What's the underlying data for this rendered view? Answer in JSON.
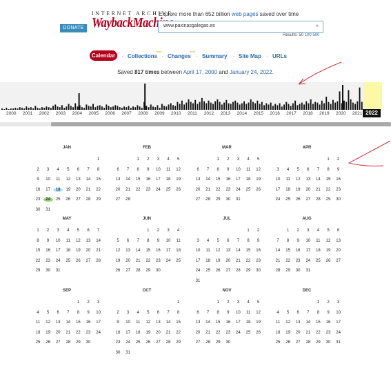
{
  "header": {
    "ia_label": "INTERNET ARCHIVE",
    "wayback_label": "WaybackMachine",
    "donate_label": "DONATE",
    "tagline_pre": "Explore more than 652 billion ",
    "tagline_link": "web pages",
    "tagline_post": " saved over time",
    "search_value": "www.paxinasgalegas.es",
    "clear_icon": "×",
    "results_label": "Results: 50",
    "results_100": "100",
    "results_500": "500"
  },
  "nav": {
    "calendar": "Calendar",
    "collections": "Collections",
    "changes": "Changes",
    "summary": "Summary",
    "sitemap": "Site Map",
    "urls": "URLs",
    "beta": "beta",
    "sep": "·"
  },
  "summary": {
    "pre": "Saved ",
    "count": "817 times",
    "mid": " between ",
    "start": "April 17, 2000",
    "and": " and ",
    "end": "January 24, 2022",
    "post": "."
  },
  "timeline": {
    "years": [
      "2000",
      "2001",
      "2002",
      "2003",
      "2004",
      "2005",
      "2006",
      "2007",
      "2008",
      "2009",
      "2010",
      "2011",
      "2012",
      "2013",
      "2014",
      "2015",
      "2016",
      "2017",
      "2018",
      "2019",
      "2020",
      "2021"
    ],
    "current_year": "2022",
    "bars": [
      2,
      1,
      3,
      1,
      2,
      2,
      3,
      2,
      4,
      3,
      2,
      5,
      3,
      4,
      2,
      6,
      3,
      2,
      4,
      3,
      5,
      4,
      3,
      6,
      8,
      5,
      4,
      7,
      3,
      5,
      9,
      6,
      4,
      10,
      5,
      7,
      4,
      3,
      8,
      6,
      5,
      9,
      4,
      6,
      7,
      5,
      3,
      8,
      6,
      4,
      5,
      7,
      6,
      4,
      3,
      5,
      4,
      6,
      3,
      5,
      4,
      7,
      5,
      3,
      12,
      6,
      4,
      8,
      5,
      4,
      7,
      3,
      9,
      6,
      5,
      8,
      10,
      7,
      6,
      12,
      9,
      14,
      8,
      11,
      16,
      12,
      10,
      15,
      9,
      12,
      18,
      13,
      10,
      14,
      11,
      9,
      13,
      16,
      12,
      8,
      11,
      15,
      10,
      9,
      12,
      14,
      11,
      8,
      10,
      13,
      9,
      11,
      16,
      12,
      10,
      14,
      9,
      12,
      7,
      10,
      8,
      11,
      6,
      9,
      7,
      10,
      5,
      8,
      12,
      9,
      6,
      10,
      14,
      7,
      9,
      11,
      8,
      13,
      10,
      16,
      9,
      12,
      11,
      8,
      14,
      10,
      20,
      12,
      9,
      15,
      11,
      13,
      28,
      10,
      14,
      12,
      30,
      16,
      11,
      9,
      13,
      34,
      12
    ],
    "bar_spikes": {
      "2004": 24,
      "2008": 38,
      "2020": 36
    }
  },
  "calendar": {
    "months": [
      {
        "name": "JAN",
        "first": 6,
        "days": 31,
        "active": [
          18,
          24
        ]
      },
      {
        "name": "FEB",
        "first": 2,
        "days": 28,
        "active": []
      },
      {
        "name": "MAR",
        "first": 2,
        "days": 31,
        "active": []
      },
      {
        "name": "APR",
        "first": 5,
        "days": 30,
        "active": []
      },
      {
        "name": "MAY",
        "first": 0,
        "days": 31,
        "active": []
      },
      {
        "name": "JUN",
        "first": 3,
        "days": 30,
        "active": []
      },
      {
        "name": "JUL",
        "first": 5,
        "days": 31,
        "active": []
      },
      {
        "name": "AUG",
        "first": 1,
        "days": 31,
        "active": []
      },
      {
        "name": "SEP",
        "first": 4,
        "days": 30,
        "active": []
      },
      {
        "name": "OCT",
        "first": 6,
        "days": 31,
        "active": []
      },
      {
        "name": "NOV",
        "first": 2,
        "days": 30,
        "active": []
      },
      {
        "name": "DEC",
        "first": 4,
        "days": 31,
        "active": []
      }
    ]
  },
  "colors": {
    "accent": "#b3001b",
    "link": "#2867ae",
    "donate": "#3a8dba",
    "highlight": "#fcf9a6",
    "arrow": "#d9303a"
  }
}
